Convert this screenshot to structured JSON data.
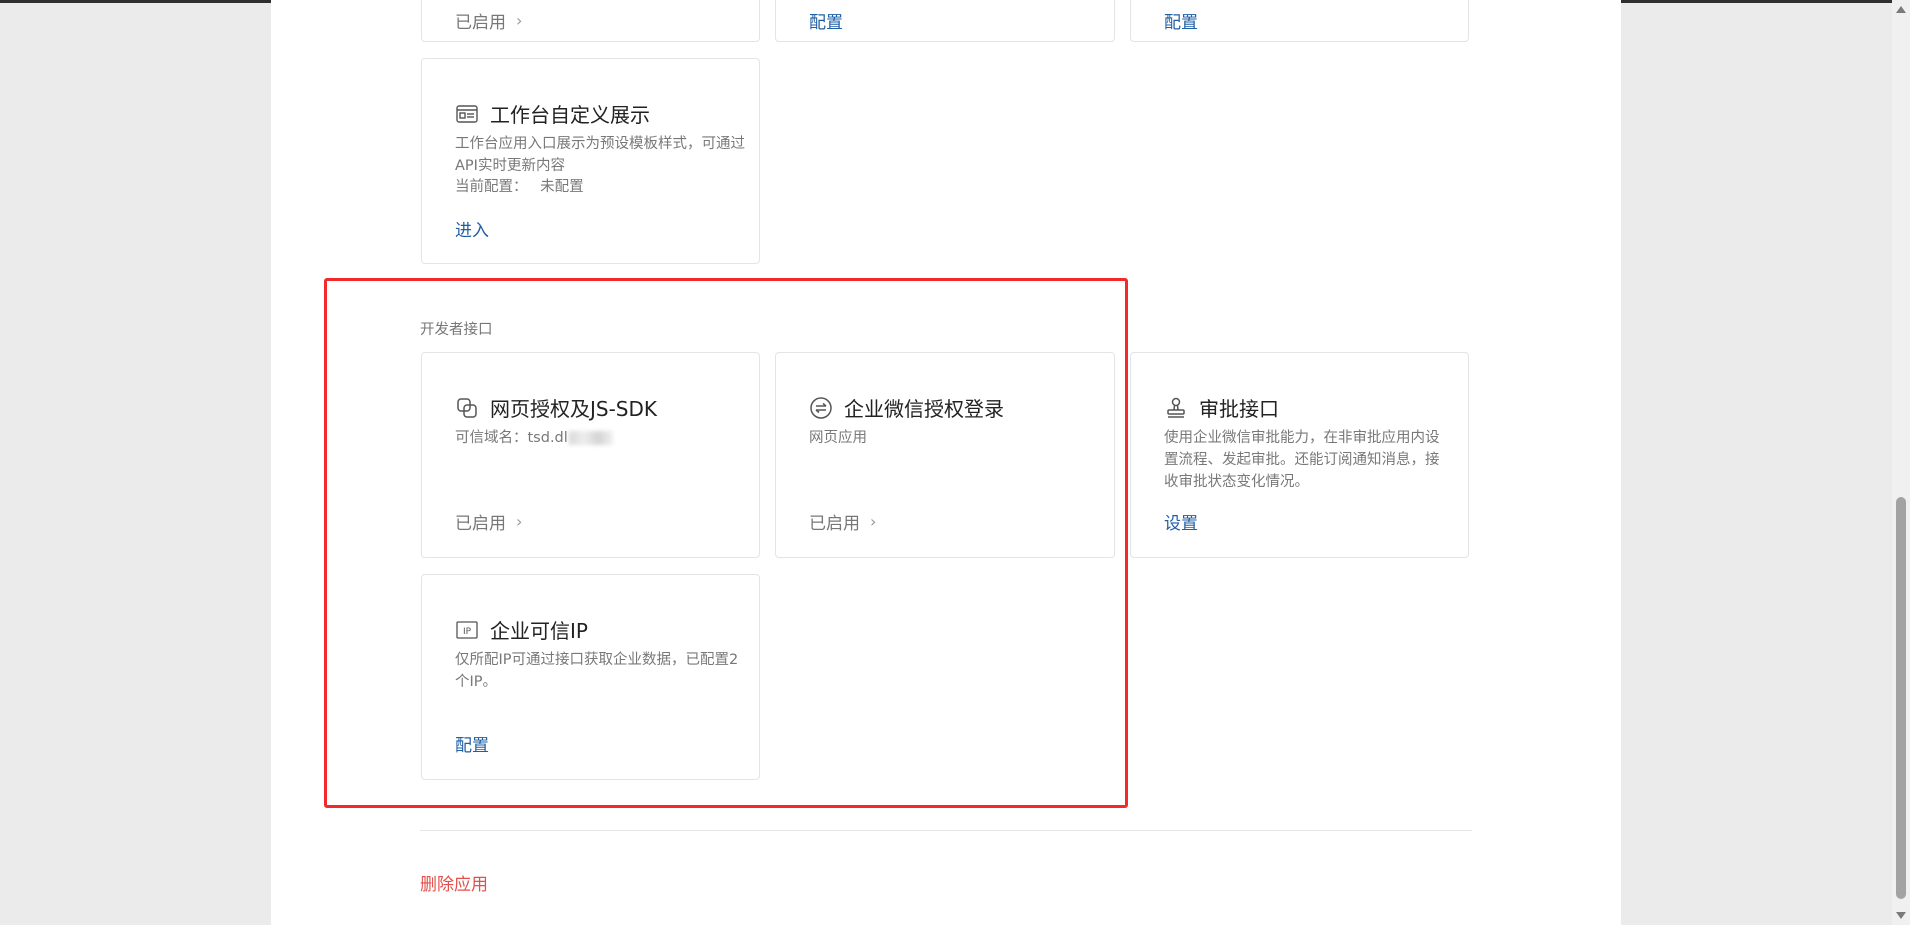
{
  "top_cards": {
    "card_1_status": "已启用",
    "card_2_action": "配置",
    "card_3_action": "配置"
  },
  "workbench_card": {
    "title": "工作台自定义展示",
    "description": "工作台应用入口展示为预设模板样式，可通过API实时更新内容",
    "current_label": "当前配置：",
    "current_value": "未配置",
    "action": "进入",
    "icon": "id-card-icon"
  },
  "developer_section": {
    "title": "开发者接口",
    "cards": [
      {
        "title": "网页授权及JS-SDK",
        "description": "可信域名：tsd.dl",
        "status": "已启用",
        "icon": "copy-link-icon"
      },
      {
        "title": "企业微信授权登录",
        "description": "网页应用",
        "status": "已启用",
        "icon": "swap-circle-icon"
      },
      {
        "title": "审批接口",
        "description": "使用企业微信审批能力，在非审批应用内设置流程、发起审批。还能订阅通知消息，接收审批状态变化情况。",
        "action": "设置",
        "icon": "stamp-icon"
      },
      {
        "title": "企业可信IP",
        "description": "仅所配IP可通过接口获取企业数据，已配置2个IP。",
        "action": "配置",
        "icon": "ip-icon"
      }
    ]
  },
  "footer": {
    "delete_label": "删除应用"
  },
  "colors": {
    "link_blue": "#1f5fa6",
    "danger_red": "#e2504a",
    "highlight_red": "#f42a2a"
  }
}
